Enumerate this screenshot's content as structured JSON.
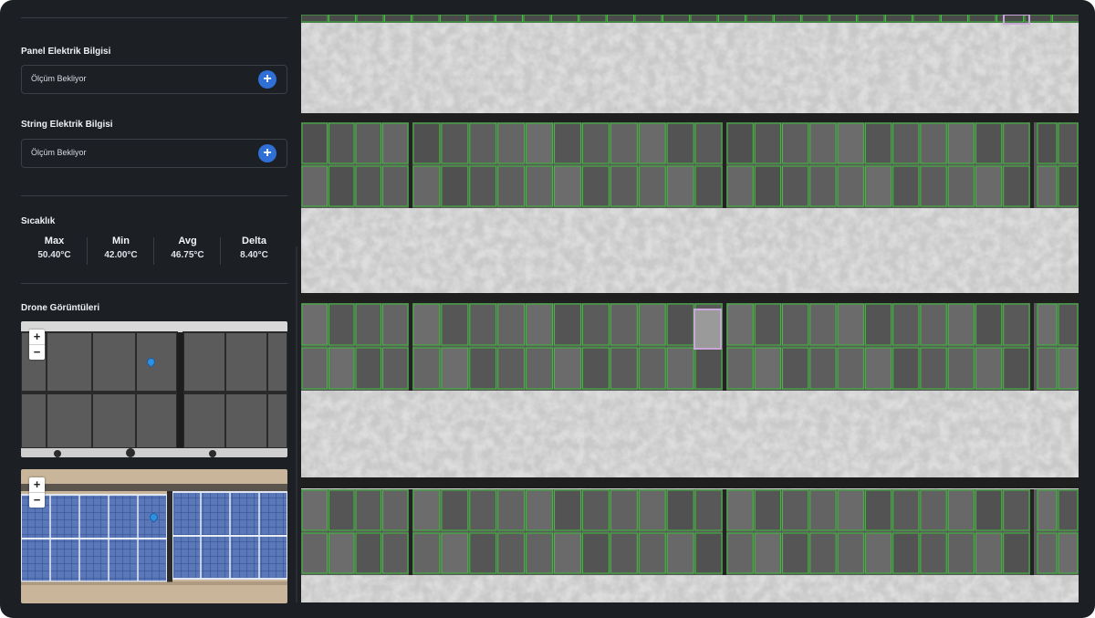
{
  "panel_info": {
    "title": "Panel Elektrik Bilgisi",
    "status": "Ölçüm Bekliyor",
    "add_icon": "plus-icon"
  },
  "string_info": {
    "title": "String Elektrik Bilgisi",
    "status": "Ölçüm Bekliyor",
    "add_icon": "plus-icon"
  },
  "temperature": {
    "title": "Sıcaklık",
    "stats": [
      {
        "label": "Max",
        "value": "50.40°C"
      },
      {
        "label": "Min",
        "value": "42.00°C"
      },
      {
        "label": "Avg",
        "value": "46.75°C"
      },
      {
        "label": "Delta",
        "value": "8.40°C"
      }
    ]
  },
  "drone": {
    "title": "Drone Görüntüleri",
    "zoom_in": "+",
    "zoom_out": "−"
  },
  "colors": {
    "background": "#1c1f24",
    "accent": "#2f6fd6",
    "detection_box": "#3fbf3a",
    "selected_box": "#c9a6d8"
  }
}
